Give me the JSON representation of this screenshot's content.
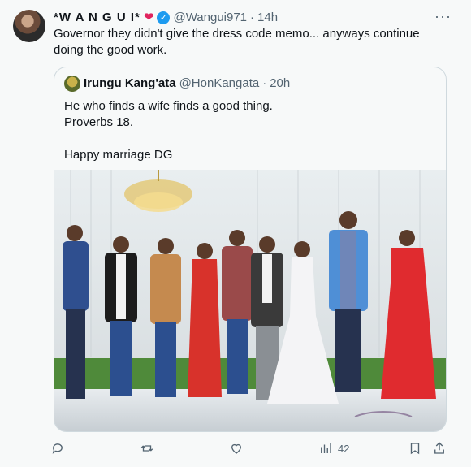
{
  "author": {
    "name": "*W A N G U I*",
    "heart": "❤",
    "handle": "@Wangui971",
    "separator": "·",
    "time": "14h"
  },
  "more_label": "···",
  "text": "Governor they didn't give the dress code memo... anyways continue doing the good work.",
  "quoted": {
    "name": "Irungu Kang'ata",
    "handle": "@HonKangata",
    "separator": "·",
    "time": "20h",
    "text": "He who finds a wife finds a good thing.\nProverbs 18.\n\nHappy marriage DG"
  },
  "actions": {
    "views_count": "42"
  },
  "colors": {
    "background": "#f7f9f9",
    "text": "#0f1419",
    "muted": "#536471",
    "verified": "#1d9bf0",
    "border": "#cfd9de"
  }
}
